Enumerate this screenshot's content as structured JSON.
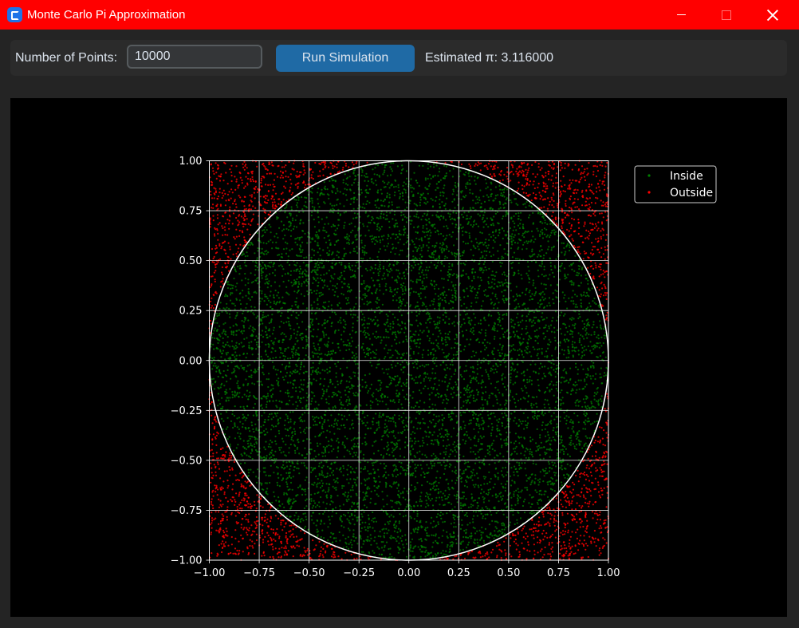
{
  "window": {
    "title": "Monte Carlo Pi Approximation",
    "icon": "app-logo-icon",
    "controls": [
      "minimize-icon",
      "maximize-icon",
      "close-icon"
    ]
  },
  "controls": {
    "points_label": "Number of Points:",
    "points_value": "10000",
    "run_label": "Run Simulation",
    "estimate_text": "Estimated π: 3.116000"
  },
  "colors": {
    "titlebar": "#ff0000",
    "accent": "#1f6aa5",
    "inside": "#008000",
    "outside": "#ff0000",
    "plot_background": "#000000",
    "foreground": "#ffffff"
  },
  "chart_data": {
    "type": "scatter",
    "title": "",
    "xlabel": "",
    "ylabel": "",
    "xlim": [
      -1.0,
      1.0
    ],
    "ylim": [
      -1.0,
      1.0
    ],
    "xticks": [
      "−1.00",
      "−0.75",
      "−0.50",
      "−0.25",
      "0.00",
      "0.25",
      "0.50",
      "0.75",
      "1.00"
    ],
    "yticks": [
      "1.00",
      "0.75",
      "0.50",
      "0.25",
      "0.00",
      "−0.25",
      "−0.50",
      "−0.75",
      "−1.00"
    ],
    "grid": true,
    "circle": {
      "center": [
        0,
        0
      ],
      "radius": 1
    },
    "legend": {
      "placement": "outside upper right",
      "entries": [
        "Inside",
        "Outside"
      ]
    },
    "series": [
      {
        "name": "Inside",
        "color": "#008000",
        "count": 7790
      },
      {
        "name": "Outside",
        "color": "#ff0000",
        "count": 2210
      }
    ],
    "total_points": 10000
  }
}
